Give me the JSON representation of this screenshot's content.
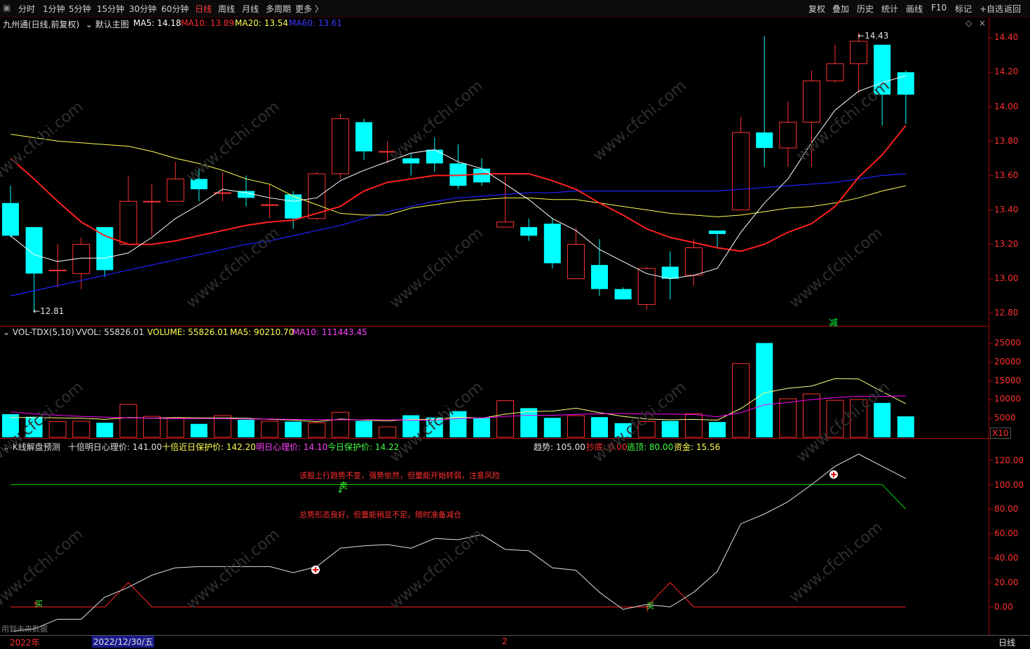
{
  "toolbar": {
    "left_tabs": [
      "分时",
      "1分钟",
      "5分钟",
      "15分钟",
      "30分钟",
      "60分钟",
      "日线",
      "周线",
      "月线",
      "多周期",
      "更多 〉"
    ],
    "active_tab": "日线",
    "right_buttons": [
      "复权",
      "叠加",
      "历史",
      "统计",
      "画线",
      "F10",
      "标记",
      "+自选",
      "返回"
    ]
  },
  "main_panel": {
    "stock_title": "九州通(日线,前复权)",
    "template": "默认主图",
    "ma5": "MA5: 14.18",
    "ma10": "MA10: 13.89",
    "ma20": "MA20: 13.54",
    "ma60": "MA60: 13.61",
    "high_label": "14.43",
    "low_label": "12.81",
    "marker": "减",
    "y_ticks": [
      "14.40",
      "14.20",
      "14.00",
      "13.80",
      "13.60",
      "13.40",
      "13.20",
      "13.00",
      "12.80"
    ]
  },
  "volume_panel": {
    "name": "VOL-TDX(5,10)",
    "vvol": "VVOL: 55826.01",
    "volume": "VOLUME: 55826.01",
    "ma5": "MA5: 90210.70",
    "ma10": "MA10: 111443.45",
    "unit": "X10",
    "y_ticks": [
      "25000",
      "20000",
      "15000",
      "10000",
      "5000"
    ]
  },
  "indicator_panel": {
    "name": "K线解盘预测",
    "psych": "十倍明日心理价: 141.00",
    "protect": "十倍近日保护价: 142.20",
    "tomorrow": "明日心理价: 14.10",
    "today": "今日保护价: 14.22",
    "trend": "趋势: 105.00",
    "bottom": "抄底: 0.00",
    "escape": "逃顶: 80.00",
    "fund": "资金: 15.56",
    "msg1": "该股上行趋势不变，强势依然，但量能开始转弱，注意风险",
    "msg2": "总势形态良好，但量能稍显不足，随时准备减仓",
    "sell_label": "卖",
    "buy_label": "买",
    "y_ticks": [
      "120.00",
      "100.00",
      "80.00",
      "60.00",
      "40.00",
      "20.00",
      "0.00"
    ]
  },
  "footer": {
    "future_data": "用到未来数据",
    "year": "2022年",
    "date": "2022/12/30/五",
    "mid_mark": "2",
    "period": "日线"
  },
  "watermark": "www.cfchi.com",
  "colors": {
    "up": "#ff3232",
    "down": "#00ffff",
    "ma5": "#ffffff",
    "ma10": "#ff2020",
    "ma20": "#ffff50",
    "ma60": "#2020ff",
    "vma10": "#ff00ff"
  },
  "chart_data": [
    {
      "type": "candlestick",
      "series_name": "九州通",
      "ohlc": [
        [
          13.44,
          13.25,
          13.54,
          13.24
        ],
        [
          13.3,
          13.03,
          13.3,
          12.81
        ],
        [
          13.05,
          13.05,
          13.2,
          12.95
        ],
        [
          13.03,
          13.2,
          13.24,
          12.94
        ],
        [
          13.3,
          13.05,
          13.3,
          13.01
        ],
        [
          13.2,
          13.45,
          13.6,
          13.2
        ],
        [
          13.45,
          13.45,
          13.55,
          13.25
        ],
        [
          13.45,
          13.58,
          13.68,
          13.45
        ],
        [
          13.58,
          13.52,
          13.64,
          13.45
        ],
        [
          13.5,
          13.5,
          13.62,
          13.45
        ],
        [
          13.51,
          13.47,
          13.6,
          13.42
        ],
        [
          13.43,
          13.43,
          13.55,
          13.35
        ],
        [
          13.49,
          13.35,
          13.51,
          13.29
        ],
        [
          13.35,
          13.61,
          13.62,
          13.34
        ],
        [
          13.61,
          13.93,
          13.96,
          13.58
        ],
        [
          13.91,
          13.74,
          13.93,
          13.69
        ],
        [
          13.74,
          13.74,
          13.8,
          13.67
        ],
        [
          13.7,
          13.67,
          13.73,
          13.6
        ],
        [
          13.75,
          13.67,
          13.82,
          13.62
        ],
        [
          13.67,
          13.54,
          13.78,
          13.52
        ],
        [
          13.64,
          13.56,
          13.7,
          13.54
        ],
        [
          13.3,
          13.33,
          13.6,
          13.33
        ],
        [
          13.3,
          13.25,
          13.35,
          13.22
        ],
        [
          13.32,
          13.09,
          13.35,
          13.06
        ],
        [
          13.0,
          13.2,
          13.3,
          13.0
        ],
        [
          13.08,
          12.94,
          13.23,
          12.9
        ],
        [
          12.94,
          12.88,
          12.95,
          12.88
        ],
        [
          12.85,
          13.06,
          13.07,
          12.82
        ],
        [
          13.07,
          13.0,
          13.16,
          12.88
        ],
        [
          13.02,
          13.18,
          13.23,
          12.96
        ],
        [
          13.28,
          13.26,
          13.28,
          13.18
        ],
        [
          13.4,
          13.85,
          13.94,
          13.4
        ],
        [
          13.85,
          13.76,
          14.41,
          13.65
        ],
        [
          13.76,
          13.91,
          14.03,
          13.65
        ],
        [
          13.91,
          14.15,
          14.21,
          13.65
        ],
        [
          14.15,
          14.25,
          14.36,
          14.14
        ],
        [
          14.25,
          14.38,
          14.43,
          14.08
        ],
        [
          14.36,
          14.07,
          14.36,
          13.89
        ],
        [
          14.2,
          14.07,
          14.21,
          13.9
        ]
      ],
      "ma5": [
        13.25,
        13.14,
        13.1,
        13.12,
        13.12,
        13.15,
        13.24,
        13.35,
        13.43,
        13.52,
        13.5,
        13.47,
        13.45,
        13.47,
        13.57,
        13.63,
        13.68,
        13.73,
        13.75,
        13.68,
        13.64,
        13.55,
        13.46,
        13.35,
        13.28,
        13.17,
        13.1,
        13.03,
        13.0,
        13.02,
        13.06,
        13.27,
        13.44,
        13.58,
        13.79,
        13.98,
        14.09,
        14.14,
        14.18
      ],
      "ma10": [
        13.7,
        13.58,
        13.45,
        13.33,
        13.25,
        13.2,
        13.2,
        13.22,
        13.25,
        13.28,
        13.31,
        13.33,
        13.34,
        13.38,
        13.42,
        13.51,
        13.56,
        13.58,
        13.6,
        13.6,
        13.61,
        13.61,
        13.61,
        13.57,
        13.52,
        13.44,
        13.37,
        13.29,
        13.24,
        13.21,
        13.18,
        13.16,
        13.2,
        13.27,
        13.32,
        13.42,
        13.59,
        13.72,
        13.89
      ],
      "ma20": [
        13.84,
        13.82,
        13.8,
        13.79,
        13.78,
        13.77,
        13.74,
        13.7,
        13.67,
        13.63,
        13.58,
        13.55,
        13.48,
        13.43,
        13.38,
        13.37,
        13.37,
        13.41,
        13.43,
        13.45,
        13.46,
        13.47,
        13.47,
        13.46,
        13.46,
        13.44,
        13.42,
        13.4,
        13.38,
        13.37,
        13.36,
        13.37,
        13.39,
        13.41,
        13.42,
        13.44,
        13.47,
        13.51,
        13.54
      ],
      "ma60": [
        12.9,
        12.93,
        12.96,
        12.99,
        13.02,
        13.05,
        13.08,
        13.11,
        13.14,
        13.17,
        13.2,
        13.22,
        13.25,
        13.28,
        13.31,
        13.35,
        13.39,
        13.42,
        13.45,
        13.47,
        13.48,
        13.49,
        13.5,
        13.5,
        13.51,
        13.51,
        13.51,
        13.51,
        13.51,
        13.51,
        13.51,
        13.52,
        13.53,
        13.54,
        13.55,
        13.56,
        13.58,
        13.6,
        13.61
      ]
    },
    {
      "type": "bar",
      "series_name": "VOLUME",
      "values": [
        6200,
        5500,
        4200,
        4300,
        3900,
        8800,
        5600,
        5200,
        3600,
        5800,
        4700,
        4300,
        4200,
        3900,
        6700,
        4400,
        2800,
        5900,
        5300,
        7000,
        5200,
        9800,
        7800,
        5200,
        5800,
        5400,
        3800,
        4200,
        4400,
        6300,
        4100,
        19700,
        25200,
        10300,
        11600,
        9900,
        10100,
        9200,
        5600
      ],
      "ma5": [
        5300,
        5300,
        5200,
        5100,
        4800,
        5300,
        5100,
        5300,
        5200,
        5200,
        5100,
        4800,
        4600,
        4200,
        4900,
        4600,
        4400,
        4800,
        4800,
        5400,
        5100,
        6200,
        6900,
        7000,
        7800,
        6600,
        5600,
        4900,
        4700,
        4800,
        4600,
        7700,
        11900,
        13100,
        13700,
        15700,
        15600,
        12200,
        9000
      ],
      "ma10": [
        6800,
        6300,
        5900,
        5600,
        5400,
        5200,
        5100,
        5000,
        5000,
        5000,
        4900,
        4900,
        4800,
        4700,
        4700,
        4700,
        4700,
        4600,
        4600,
        5000,
        5200,
        5600,
        5900,
        5900,
        6100,
        6300,
        6400,
        6200,
        6200,
        6100,
        5500,
        6600,
        8700,
        9300,
        10100,
        10600,
        11000,
        10900,
        11100
      ]
    },
    {
      "type": "line",
      "series_name": "趋势",
      "values": [
        -20,
        -18,
        -10,
        -10,
        8,
        16,
        26,
        32,
        33,
        33,
        33,
        33,
        28,
        33,
        48,
        50,
        51,
        48,
        56,
        55,
        59,
        47,
        46,
        32,
        30,
        12,
        -2,
        2,
        0,
        12,
        29,
        68,
        76,
        86,
        100,
        115,
        125,
        115,
        105
      ],
      "escape": [
        100,
        100,
        100,
        100,
        100,
        100,
        100,
        100,
        100,
        100,
        100,
        100,
        100,
        100,
        100,
        100,
        100,
        100,
        100,
        100,
        100,
        100,
        100,
        100,
        100,
        100,
        100,
        100,
        100,
        100,
        100,
        100,
        100,
        100,
        100,
        100,
        100,
        100,
        80
      ],
      "bottom": [
        0,
        0,
        0,
        0,
        0,
        20,
        0,
        0,
        0,
        0,
        0,
        0,
        0,
        0,
        0,
        0,
        0,
        0,
        0,
        0,
        0,
        0,
        0,
        0,
        0,
        0,
        0,
        0,
        20,
        0,
        0,
        0,
        0,
        0,
        0,
        0,
        0,
        0,
        0
      ]
    }
  ]
}
